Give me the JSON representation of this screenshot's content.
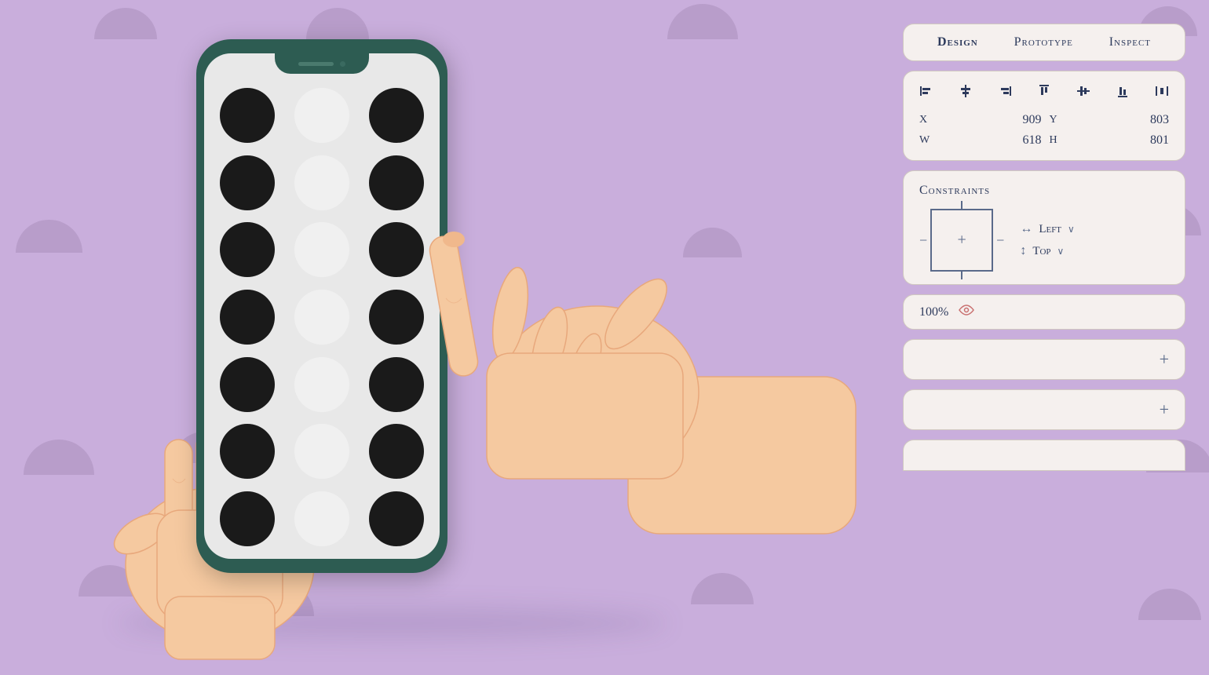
{
  "background": {
    "color": "#c9aedc",
    "decor_color": "#b89dca"
  },
  "tabs": {
    "items": [
      {
        "label": "Design",
        "id": "design",
        "active": true
      },
      {
        "label": "Prototype",
        "id": "prototype",
        "active": false
      },
      {
        "label": "Inspect",
        "id": "inspect",
        "active": false
      }
    ]
  },
  "alignment": {
    "icons": [
      "⊢",
      "⊣",
      "⊤",
      "⊥",
      "⊞",
      "⊟",
      "⊠"
    ]
  },
  "properties": {
    "x_label": "X",
    "x_value": "909",
    "y_label": "Y",
    "y_value": "803",
    "w_label": "W",
    "w_value": "618",
    "h_label": "H",
    "h_value": "801"
  },
  "constraints": {
    "title": "Constraints",
    "left_label": "Left",
    "top_label": "Top",
    "chevron": "∨"
  },
  "opacity": {
    "value": "100%",
    "eye_icon": "👁"
  },
  "plus_sections": [
    {
      "id": "plus1"
    },
    {
      "id": "plus2"
    }
  ],
  "phone": {
    "dots_pattern": [
      "black",
      "white",
      "black",
      "black",
      "white",
      "black",
      "black",
      "white",
      "black",
      "black",
      "white",
      "black",
      "black",
      "white",
      "black",
      "black",
      "white",
      "black",
      "black",
      "white",
      "black"
    ]
  }
}
